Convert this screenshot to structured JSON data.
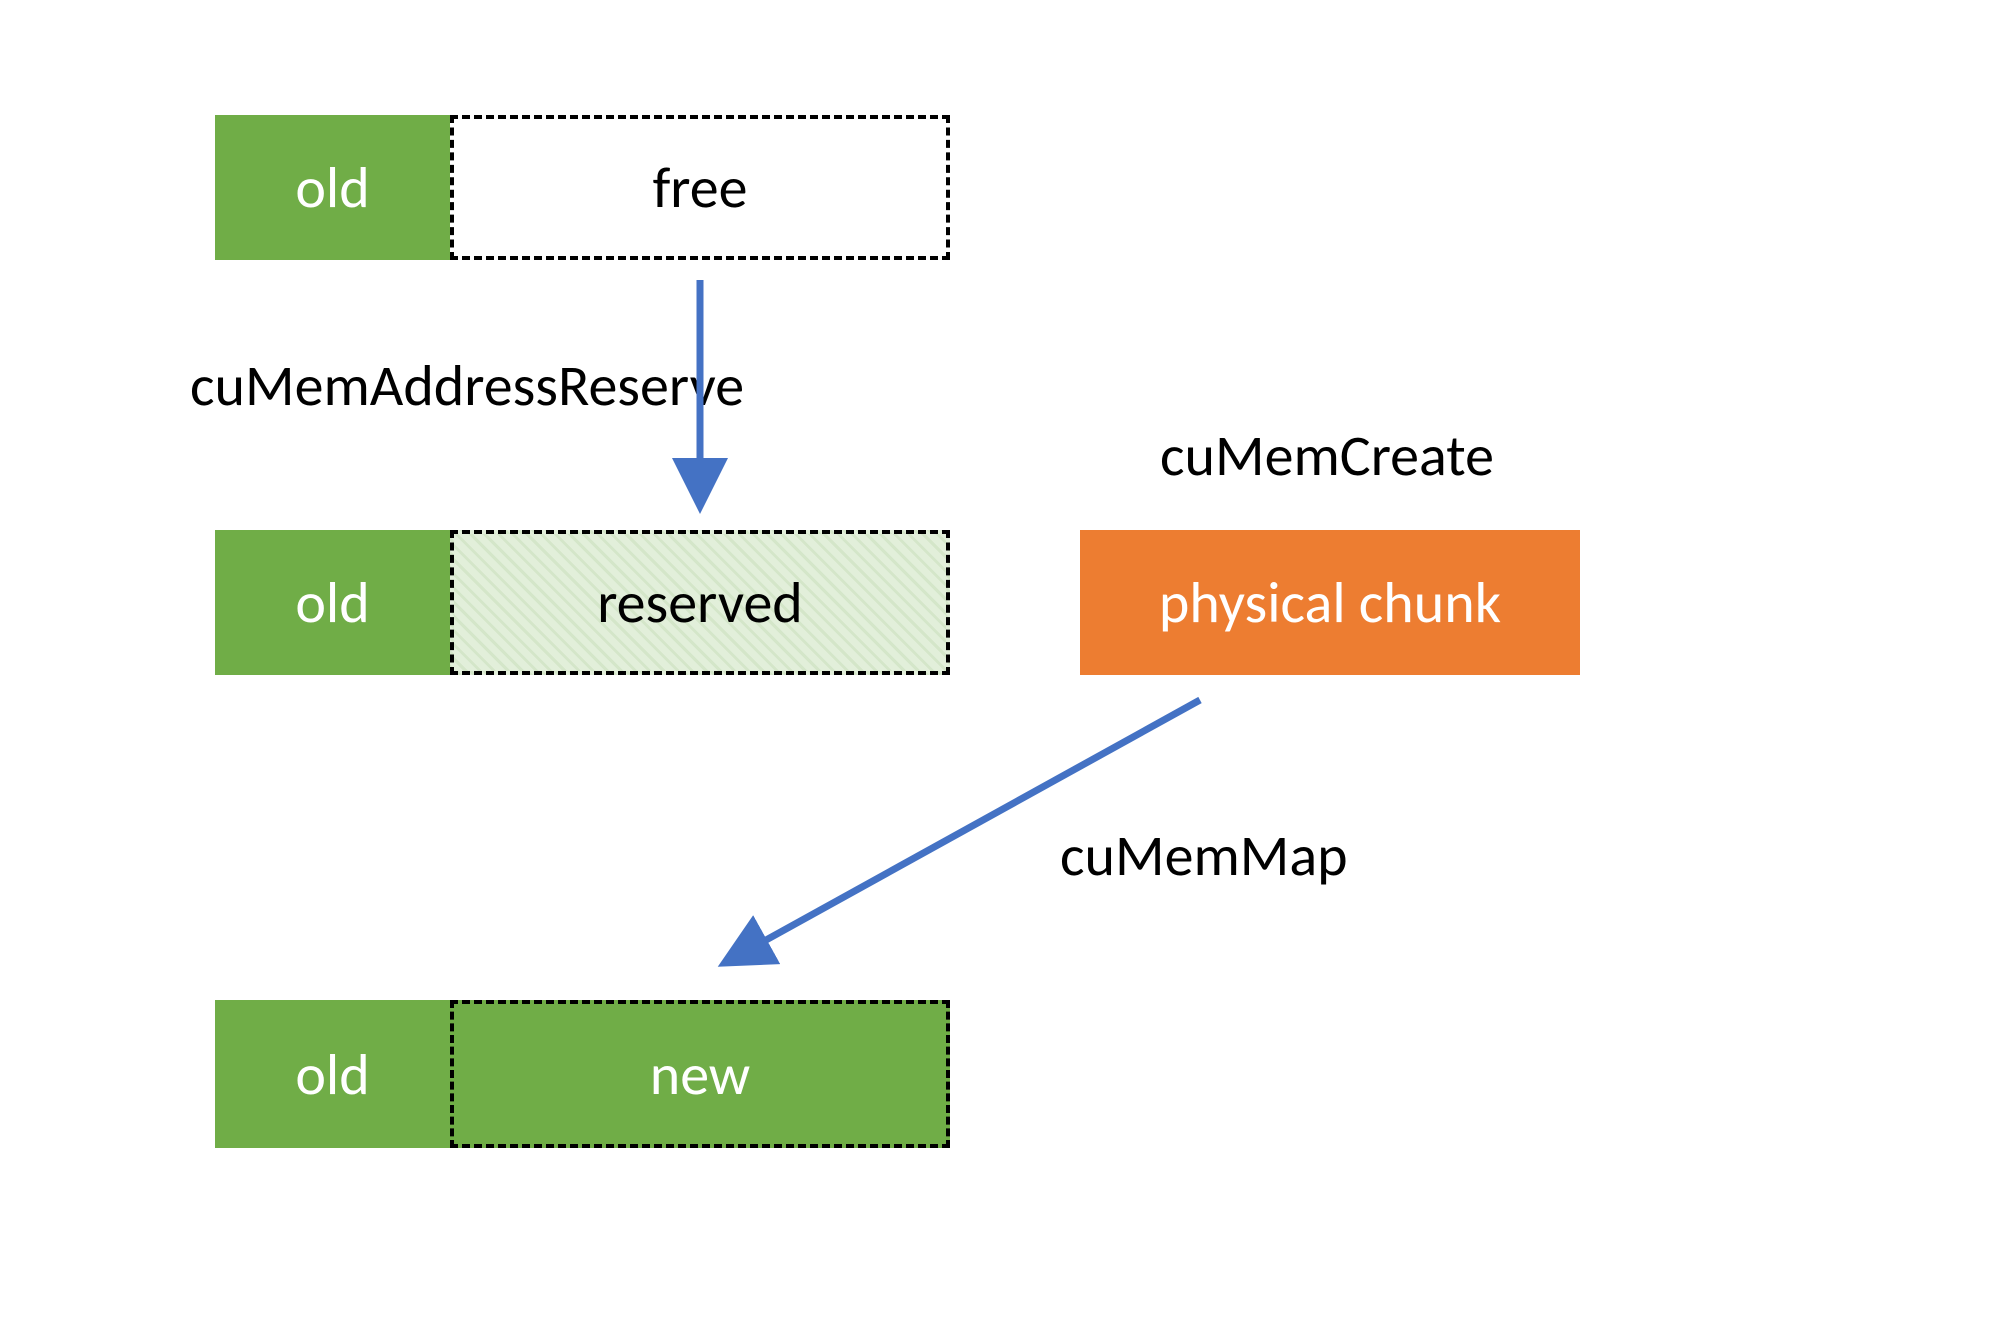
{
  "diagram": {
    "row1": {
      "old_label": "old",
      "free_label": "free"
    },
    "row2": {
      "old_label": "old",
      "reserved_label": "reserved"
    },
    "row3": {
      "old_label": "old",
      "new_label": "new"
    },
    "physical_chunk_label": "physical chunk",
    "api_reserve": "cuMemAddressReserve",
    "api_create": "cuMemCreate",
    "api_map": "cuMemMap"
  },
  "colors": {
    "green": "#70AD47",
    "orange": "#ED7D31",
    "arrow": "#4472C4",
    "reserved_fill": "#E2EFDA"
  }
}
